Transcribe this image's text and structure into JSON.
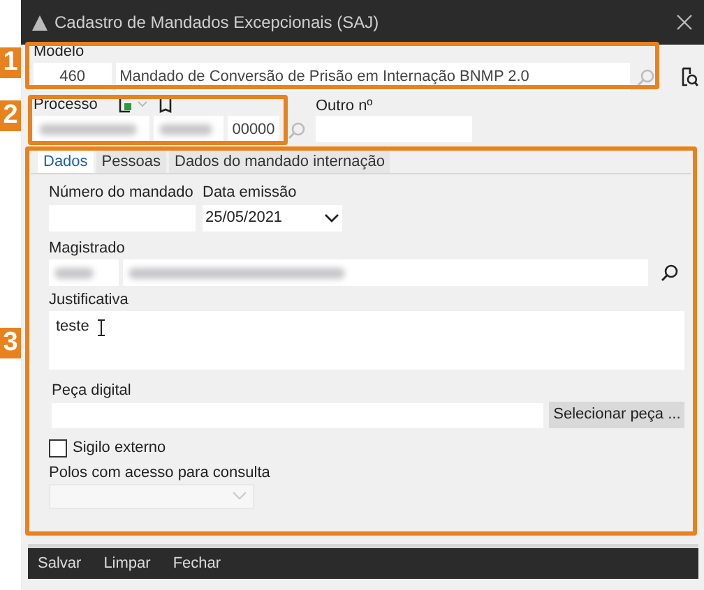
{
  "window": {
    "title": "Cadastro de Mandados Excepcionais (SAJ)"
  },
  "modelo": {
    "label": "Modelo",
    "code": "460",
    "description": "Mandado de Conversão de Prisão em Internação BNMP 2.0"
  },
  "processo": {
    "label": "Processo",
    "suffix": "00000"
  },
  "outro_numero": {
    "label": "Outro nº"
  },
  "tabs": [
    {
      "label": "Dados",
      "selected": true
    },
    {
      "label": "Pessoas",
      "selected": false
    },
    {
      "label": "Dados do mandado internação",
      "selected": false
    }
  ],
  "dados": {
    "numero_label": "Número do mandado",
    "data_label": "Data emissão",
    "data_value": "25/05/2021",
    "magistrado_label": "Magistrado",
    "justificativa_label": "Justificativa",
    "justificativa_value": "teste",
    "peca_label": "Peça digital",
    "peca_button": "Selecionar peça ...",
    "sigilo": {
      "label": "Sigilo externo",
      "checked": false
    },
    "polos_label": "Polos com acesso para consulta"
  },
  "actions": [
    "Salvar",
    "Limpar",
    "Fechar"
  ],
  "callouts": [
    {
      "number": "1"
    },
    {
      "number": "2"
    },
    {
      "number": "3"
    }
  ]
}
